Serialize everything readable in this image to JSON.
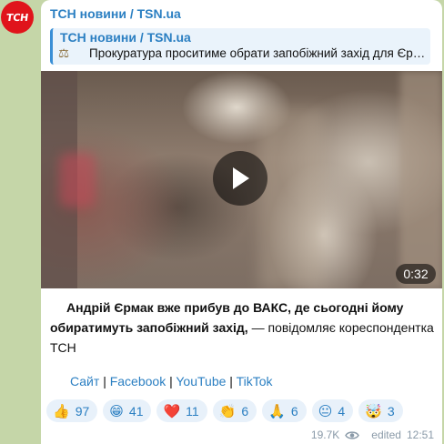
{
  "avatar": {
    "text": "ТСН",
    "color": "#e0141b"
  },
  "channel": {
    "name": "ТСН новини / TSN.ua"
  },
  "reply": {
    "title": "ТСН новини / TSN.ua",
    "icon": "scales-icon",
    "text": "Прокуратура проситиме обрати запобіжний захід для Єрмака"
  },
  "video": {
    "duration": "0:32"
  },
  "post": {
    "bold": "Андрій Єрмак вже прибув до ВАКС, де сьогодні йому обиратимуть запобіжний захід,",
    "rest": " — повідомляє кореспондентка ТСН"
  },
  "links": {
    "site": "Сайт",
    "sep1": "|",
    "facebook": "Facebook",
    "sep2": "|",
    "youtube": "YouTube",
    "sep3": "|",
    "tiktok": "TikTok"
  },
  "reactions": [
    {
      "emoji": "👍",
      "count": "97"
    },
    {
      "emoji": "😁",
      "count": "41"
    },
    {
      "emoji": "❤️",
      "count": "11"
    },
    {
      "emoji": "👏",
      "count": "6"
    },
    {
      "emoji": "🙏",
      "count": "6"
    },
    {
      "emoji": "😐",
      "count": "4"
    },
    {
      "emoji": "🤯",
      "count": "3"
    }
  ],
  "meta": {
    "views": "19.7K",
    "edited": "edited",
    "time": "12:51"
  }
}
